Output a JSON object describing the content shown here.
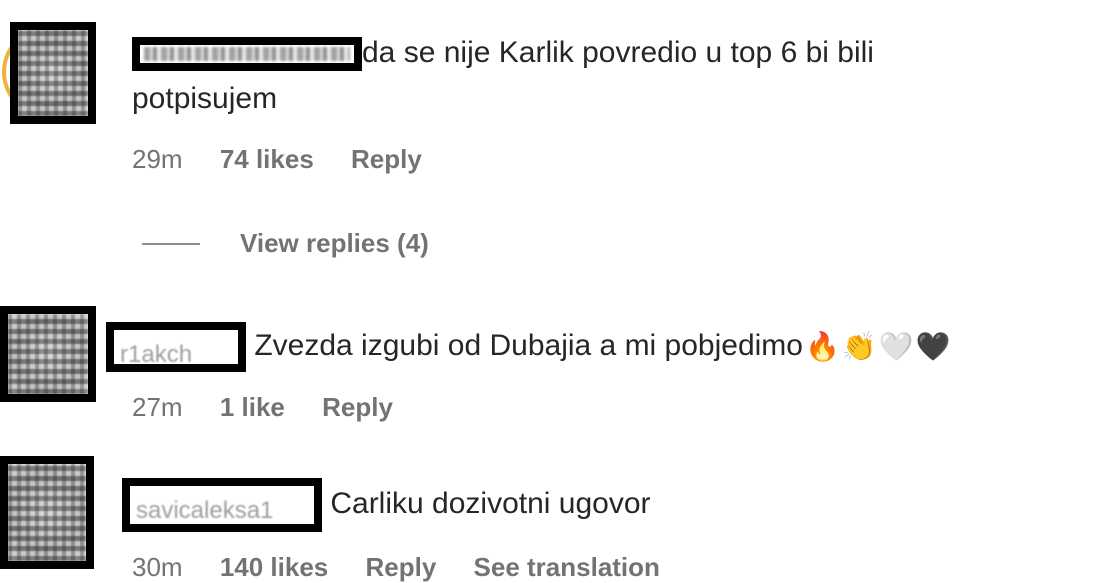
{
  "comments": [
    {
      "username": "",
      "text_a": "da se nije Karlik povredio u top 6 bi bili",
      "text_b": "potpisujem",
      "time": "29m",
      "likes": "74 likes",
      "reply": "Reply",
      "view_replies": "View replies (4)"
    },
    {
      "username": "r1akch",
      "text": "Zvezda izgubi od Dubajia a mi pobjedimo",
      "emojis": [
        "🔥",
        "👏",
        "🤍",
        "🖤"
      ],
      "time": "27m",
      "likes": "1 like",
      "reply": "Reply"
    },
    {
      "username": "savicaleksa1",
      "text": "Carliku dozivotni ugovor",
      "time": "30m",
      "likes": "140 likes",
      "reply": "Reply",
      "translate": "See translation"
    }
  ]
}
